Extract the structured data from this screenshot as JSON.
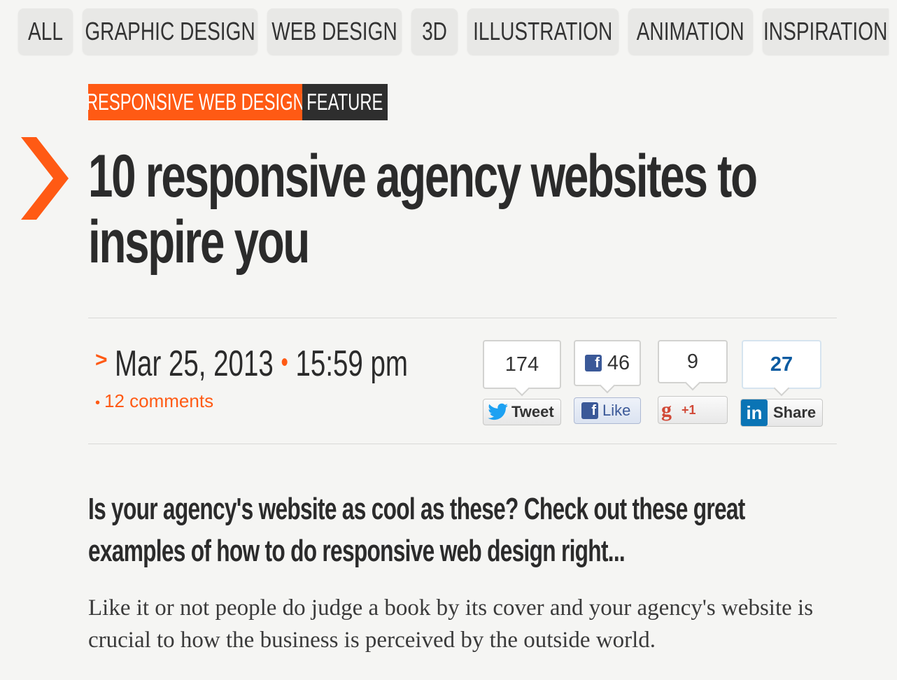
{
  "nav": {
    "items": [
      {
        "label": "ALL"
      },
      {
        "label": "GRAPHIC DESIGN"
      },
      {
        "label": "WEB DESIGN"
      },
      {
        "label": "3D"
      },
      {
        "label": "ILLUSTRATION"
      },
      {
        "label": "ANIMATION"
      },
      {
        "label": "INSPIRATION"
      }
    ]
  },
  "article": {
    "category_tag": "RESPONSIVE WEB DESIGN",
    "type_tag": "FEATURE",
    "title": "10 responsive agency websites to inspire you",
    "date": "Mar 25, 2013",
    "time": "15:59 pm",
    "comments": "12 comments",
    "standfirst": "Is your agency's website as cool as these? Check out these great examples of how to do responsive web design right...",
    "body": "Like it or not people do judge a book by its cover and your agency's website is crucial to how the business is perceived by the outside world."
  },
  "social": {
    "twitter": {
      "count": "174",
      "label": "Tweet"
    },
    "facebook": {
      "count": "46",
      "label": "Like"
    },
    "googleplus": {
      "count": "9",
      "label": "+1"
    },
    "linkedin": {
      "count": "27",
      "label": "Share"
    }
  },
  "colors": {
    "accent": "#ff5a14",
    "dark": "#2e2e2e",
    "facebook": "#3b5998",
    "linkedin": "#0a74b5",
    "twitter": "#1da1f2",
    "googleplus": "#d14836"
  }
}
